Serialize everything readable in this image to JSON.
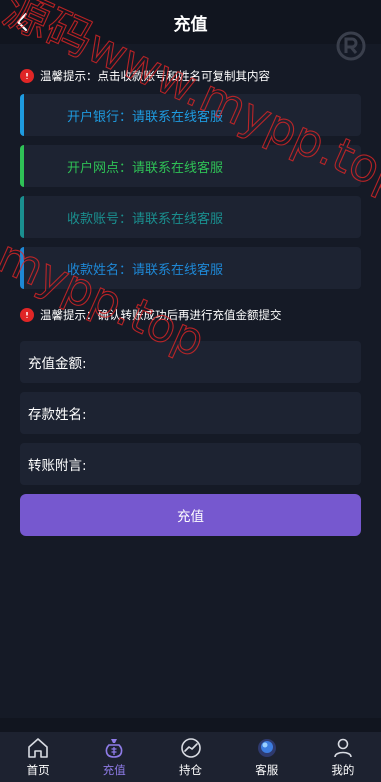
{
  "header": {
    "title": "充值"
  },
  "tips": {
    "copy_tip": "温馨提示：点击收款账号和姓名可复制其内容",
    "confirm_tip": "温馨提示：确认转账成功后再进行充值金额提交"
  },
  "bank_info": [
    {
      "label": "开户银行：",
      "value": "请联系在线客服",
      "color": "#1e9be0"
    },
    {
      "label": "开户网点：",
      "value": "请联系在线客服",
      "color": "#2fc156"
    },
    {
      "label": "收款账号：",
      "value": "请联系在线客服",
      "color": "#1a8f8f"
    },
    {
      "label": "收款姓名：",
      "value": "请联系在线客服",
      "color": "#1e88d6"
    }
  ],
  "form": {
    "amount_label": "充值金额:",
    "amount_value": "",
    "name_label": "存款姓名:",
    "name_value": "",
    "note_label": "转账附言:",
    "note_value": ""
  },
  "submit_label": "充值",
  "tabbar": [
    {
      "label": "首页",
      "icon": "home-icon",
      "active": false
    },
    {
      "label": "充值",
      "icon": "money-bag-icon",
      "active": true
    },
    {
      "label": "持仓",
      "icon": "chart-icon",
      "active": false
    },
    {
      "label": "客服",
      "icon": "customer-service-icon",
      "active": false
    },
    {
      "label": "我的",
      "icon": "user-icon",
      "active": false
    }
  ],
  "watermark": {
    "line1": "源码www.mypp.top",
    "line2": "mypp.top"
  },
  "colors": {
    "accent": "#7658cf",
    "warning": "#e02626",
    "watermark": "#e02626",
    "active_tab": "#8f7ce8"
  }
}
